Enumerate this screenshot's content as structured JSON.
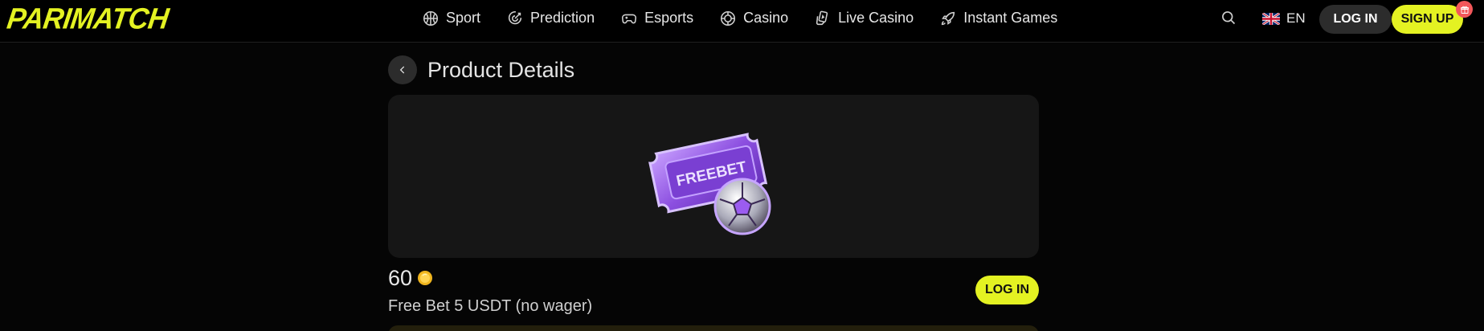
{
  "header": {
    "logo_text": "PARIMATCH",
    "nav": [
      {
        "label": "Sport",
        "icon": "basketball-icon"
      },
      {
        "label": "Prediction",
        "icon": "target-icon"
      },
      {
        "label": "Esports",
        "icon": "gamepad-icon"
      },
      {
        "label": "Casino",
        "icon": "chip-icon"
      },
      {
        "label": "Live Casino",
        "icon": "card-hand-icon"
      },
      {
        "label": "Instant Games",
        "icon": "rocket-icon"
      }
    ],
    "language": "EN",
    "login_label": "LOG IN",
    "signup_label": "SIGN UP"
  },
  "page": {
    "title": "Product Details",
    "product": {
      "image_label": "FREEBET",
      "price": "60",
      "name": "Free Bet 5 USDT (no wager)",
      "login_label": "LOG IN"
    }
  },
  "colors": {
    "brand_yellow": "#e4f222",
    "background": "#050505",
    "card": "#161616",
    "button_dark": "#2c2c2c",
    "badge_red": "#f2575a"
  }
}
